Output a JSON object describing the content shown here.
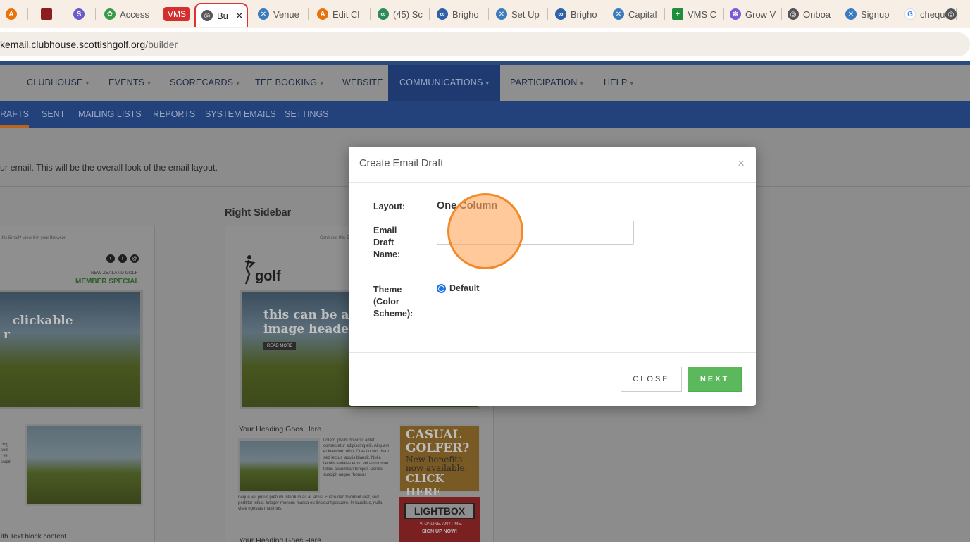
{
  "browser": {
    "tabs": [
      {
        "label": "",
        "icon": "a-orange-icon",
        "color": "#e8730c"
      },
      {
        "label": "",
        "icon": "square-red-icon",
        "color": "#8b1e1e"
      },
      {
        "label": "",
        "icon": "swirl-icon",
        "color": "#6a5acd"
      },
      {
        "label": "Access",
        "icon": "leaf-icon",
        "color": "#3a9b47"
      },
      {
        "label": "VMS",
        "icon": "vms-badge-icon",
        "color": "#d32f2f"
      },
      {
        "label": "Bu",
        "icon": "globe-icon",
        "color": "#555555"
      },
      {
        "label": "Venue",
        "icon": "saltire-icon",
        "color": "#3b7bbf"
      },
      {
        "label": "Edit Cl",
        "icon": "a-orange-icon",
        "color": "#e8730c"
      },
      {
        "label": "(45) Sc",
        "icon": "link-icon",
        "color": "#2e8b57"
      },
      {
        "label": "Brigho",
        "icon": "chain-icon",
        "color": "#2d62a8"
      },
      {
        "label": "Set Up",
        "icon": "saltire-icon",
        "color": "#3b7bbf"
      },
      {
        "label": "Brigho",
        "icon": "chain-icon",
        "color": "#2d62a8"
      },
      {
        "label": "Capital",
        "icon": "saltire-icon",
        "color": "#3b7bbf"
      },
      {
        "label": "VMS C",
        "icon": "plus-green-icon",
        "color": "#1e8e3e"
      },
      {
        "label": "Grow V",
        "icon": "flower-icon",
        "color": "#7b5bd6"
      },
      {
        "label": "Onboa",
        "icon": "globe-icon",
        "color": "#555555"
      },
      {
        "label": "Signup",
        "icon": "saltire-icon",
        "color": "#3b7bbf"
      },
      {
        "label": "cheque",
        "icon": "google-icon",
        "color": "#4285f4"
      },
      {
        "label": "",
        "icon": "globe-icon",
        "color": "#555555"
      }
    ],
    "url_host": "kemail.clubhouse.scottishgolf.org",
    "url_path": "/builder"
  },
  "nav": {
    "items": [
      {
        "label": "CLUBHOUSE",
        "caret": "▾"
      },
      {
        "label": "EVENTS",
        "caret": "▾"
      },
      {
        "label": "SCORECARDS",
        "caret": "▾"
      },
      {
        "label": "TEE BOOKING",
        "caret": "▾"
      },
      {
        "label": "WEBSITE",
        "caret": ""
      },
      {
        "label": "COMMUNICATIONS",
        "caret": "▾"
      },
      {
        "label": "PARTICIPATION",
        "caret": "▾"
      },
      {
        "label": "HELP",
        "caret": "▾"
      }
    ],
    "sub_items": [
      "RAFTS",
      "SENT",
      "MAILING LISTS",
      "REPORTS",
      "SYSTEM EMAILS",
      "SETTINGS"
    ]
  },
  "page": {
    "description": "ur email. This will be the overall look of the email layout.",
    "right_sidebar_title": "Right Sidebar",
    "left_card": {
      "view_link": "this Email? View it in your Browser",
      "social_icons": [
        "twitter-icon",
        "facebook-icon",
        "email-icon"
      ],
      "org": "NEW ZEALAND GOLF",
      "badge": "MEMBER SPECIAL",
      "hero_line1": "clickable",
      "hero_line2": "r",
      "side_text": "cing\nsed\n, vel\nscipit",
      "footer_text": "ith Text block content"
    },
    "right_card": {
      "view_link": "Can't see this E",
      "logo_text": "golf",
      "hero_line1": "this can be a cl",
      "hero_line2": "image header",
      "read_more": "READ MORE",
      "heading1": "Your Heading Goes Here",
      "lorem": "Lorem ipsum dolor sit amet, consectetur adipiscing elit. Aliquam et interdum nibh. Cras cursus diam sed lectus iaculis blandit. Nulla iaculis sodales eros, vel accumsan tellus accumsan tempor. Donec suscipit augue rhoncus",
      "lorem2": "neque vel purus pretium interdum ac at lacus. Fusce nec tincidunt erat, sed porttitor tellus. Integer rhoncus massa eu tincidunt posuere. In faucibus, nulla vitae egestas maximus.",
      "heading2": "Your Heading Goes Here",
      "ad1_line1": "CASUAL",
      "ad1_line2": "GOLFER?",
      "ad1_line3": "New benefits",
      "ad1_line4": "now available.",
      "ad1_line5": "CLICK HERE",
      "ad2_title": "LIGHTBOX",
      "ad2_tag": "TV. ONLINE. ANYTIME.",
      "ad2_cta": "SIGN UP NOW!"
    }
  },
  "modal": {
    "title": "Create Email Draft",
    "close_symbol": "×",
    "layout_label": "Layout:",
    "layout_value": "One Column",
    "name_label_1": "Email",
    "name_label_2": "Draft",
    "name_label_3": "Name:",
    "name_value": "",
    "theme_label_1": "Theme",
    "theme_label_2": "(Color",
    "theme_label_3": "Scheme):",
    "theme_option": "Default",
    "close_button": "CLOSE",
    "next_button": "NEXT"
  },
  "colors": {
    "accent_blue": "#23417a",
    "next_green": "#5cb85c",
    "click_ring": "#f08a2a"
  }
}
